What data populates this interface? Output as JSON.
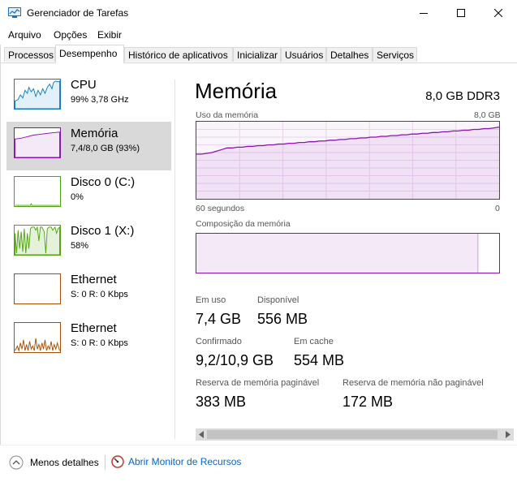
{
  "window": {
    "title": "Gerenciador de Tarefas",
    "icon": "task-manager-icon"
  },
  "menu": [
    "Arquivo",
    "Opções",
    "Exibir"
  ],
  "tabs": [
    {
      "label": "Processos"
    },
    {
      "label": "Desempenho",
      "active": true
    },
    {
      "label": "Histórico de aplicativos"
    },
    {
      "label": "Inicializar"
    },
    {
      "label": "Usuários"
    },
    {
      "label": "Detalhes"
    },
    {
      "label": "Serviços"
    }
  ],
  "sidebar": {
    "items": [
      {
        "name": "CPU",
        "sub": "99% 3,78 GHz",
        "color": "#117dbb"
      },
      {
        "name": "Memória",
        "sub": "7,4/8,0 GB (93%)",
        "color": "#8b12ae",
        "selected": true
      },
      {
        "name": "Disco 0 (C:)",
        "sub": "0%",
        "color": "#4da60c"
      },
      {
        "name": "Disco 1 (X:)",
        "sub": "58%",
        "color": "#4da60c"
      },
      {
        "name": "Ethernet",
        "sub": "S: 0 R: 0 Kbps",
        "color": "#a74f01"
      },
      {
        "name": "Ethernet",
        "sub": "S: 0 R: 0 Kbps",
        "color": "#a74f01"
      }
    ]
  },
  "main": {
    "title": "Memória",
    "spec": "8,0 GB DDR3",
    "usage_label": "Uso da memória",
    "usage_max": "8,0 GB",
    "time_left": "60 segundos",
    "time_right": "0",
    "composition_label": "Composição da memória",
    "usage_history_percent": [
      58,
      58,
      59,
      60,
      62,
      64,
      66,
      66,
      67,
      67,
      68,
      68,
      69,
      69,
      70,
      70,
      71,
      71,
      72,
      72,
      73,
      73,
      74,
      74,
      75,
      75,
      76,
      76,
      77,
      77,
      78,
      78,
      79,
      79,
      80,
      80,
      81,
      81,
      82,
      82,
      83,
      83,
      84,
      84,
      85,
      85,
      86,
      86,
      87,
      87,
      88,
      88,
      89,
      89,
      90,
      90,
      91,
      91,
      92,
      93
    ],
    "composition_in_use_percent": 93,
    "stats": {
      "in_use": {
        "label": "Em uso",
        "value": "7,4 GB"
      },
      "available": {
        "label": "Disponível",
        "value": "556 MB"
      },
      "committed": {
        "label": "Confirmado",
        "value": "9,2/10,9 GB"
      },
      "cached": {
        "label": "Em cache",
        "value": "554 MB"
      },
      "paged_pool": {
        "label": "Reserva de memória paginável",
        "value": "383 MB"
      },
      "nonpaged_pool": {
        "label": "Reserva de memória não paginável",
        "value": "172 MB"
      }
    }
  },
  "footer": {
    "less_details": "Menos detalhes",
    "open_monitor": "Abrir Monitor de Recursos"
  },
  "colors": {
    "memory": "#8b12ae",
    "cpu": "#117dbb",
    "disk": "#4da60c",
    "ethernet": "#a74f01",
    "link": "#0066cc"
  }
}
